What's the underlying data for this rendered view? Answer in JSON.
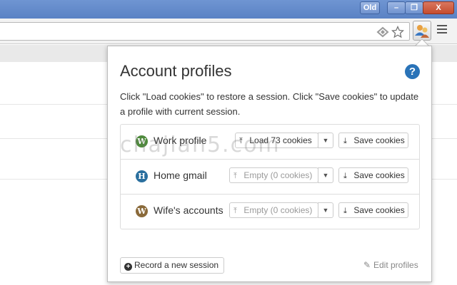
{
  "window": {
    "old_label": "Old",
    "minimize_glyph": "–",
    "restore_glyph": "❐",
    "close_glyph": "X"
  },
  "toolbar": {
    "omnibox_value": "",
    "icons": [
      "reader-mode-icon",
      "star-icon",
      "account-profiles-icon",
      "menu-icon"
    ]
  },
  "popup": {
    "title": "Account profiles",
    "help_glyph": "?",
    "description": "Click \"Load cookies\" to restore a session. Click \"Save cookies\" to update a profile with current session.",
    "profiles": [
      {
        "name": "Work profile",
        "icon_letter": "W",
        "icon_color": "#4f8a3d",
        "load_label": "Load 73 cookies",
        "empty": false,
        "save_label": "Save cookies"
      },
      {
        "name": "Home gmail",
        "icon_letter": "H",
        "icon_color": "#2a6f9e",
        "load_label": "Empty (0 cookies)",
        "empty": true,
        "save_label": "Save cookies"
      },
      {
        "name": "Wife's accounts",
        "icon_letter": "W",
        "icon_color": "#8a6a3a",
        "load_label": "Empty (0 cookies)",
        "empty": true,
        "save_label": "Save cookies"
      }
    ],
    "record_label": "Record a new session",
    "edit_label": "Edit profiles"
  },
  "watermark": "chajian5.com",
  "colors": {
    "titlebar": "#5a82c4",
    "help": "#2a73b8",
    "muted_text": "#9a9a9a"
  }
}
